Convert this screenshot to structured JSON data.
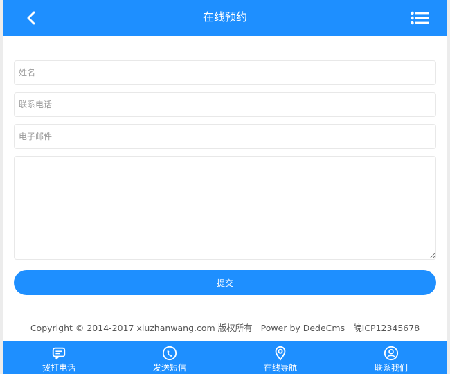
{
  "header": {
    "title": "在线预约",
    "back_icon": "chevron-left-icon",
    "menu_icon": "list-menu-icon"
  },
  "form": {
    "name_placeholder": "姓名",
    "phone_placeholder": "联系电话",
    "email_placeholder": "电子邮件",
    "message_value": "",
    "submit_label": "提交"
  },
  "footer": {
    "copyright": "Copyright © 2014-2017 xiuzhanwang.com 版权所有",
    "powered": "Power by DedeCms",
    "icp": "皖ICP12345678"
  },
  "bottom_nav": {
    "items": [
      {
        "label": "拨打电话",
        "icon": "chat-bubble-icon"
      },
      {
        "label": "发送短信",
        "icon": "phone-icon"
      },
      {
        "label": "在线导航",
        "icon": "map-pin-icon"
      },
      {
        "label": "联系我们",
        "icon": "user-circle-icon"
      }
    ]
  },
  "colors": {
    "primary": "#1e8fff",
    "background": "#ececec"
  }
}
